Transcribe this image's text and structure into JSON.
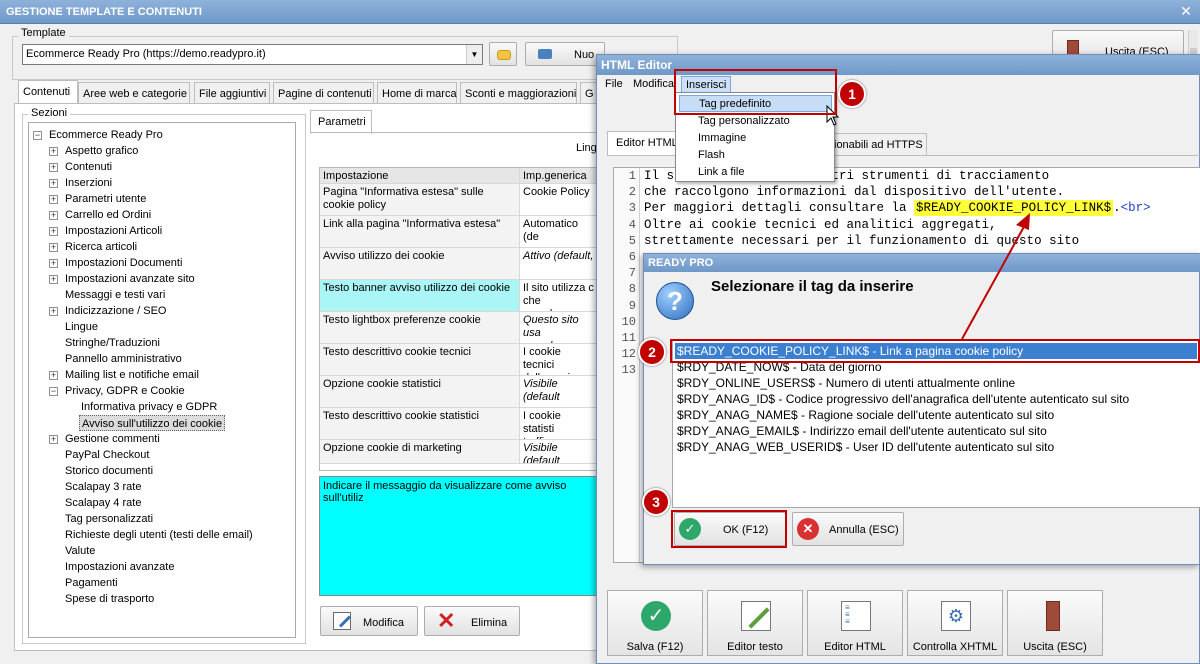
{
  "main": {
    "title": "GESTIONE TEMPLATE E CONTENUTI",
    "close": "✕",
    "template_label": "Template",
    "template_value": "Ecommerce Ready Pro (https://demo.readypro.it)",
    "new_button": "Nuo",
    "exit_button": "Uscita (ESC)",
    "tabs": [
      "Contenuti",
      "Aree web e categorie",
      "File aggiuntivi",
      "Pagine di contenuti",
      "Home di marca",
      "Sconti e maggiorazioni",
      "G"
    ],
    "sections_label": "Sezioni",
    "tree": [
      {
        "label": "Ecommerce Ready Pro",
        "level": 0,
        "toggle": "−"
      },
      {
        "label": "Aspetto grafico",
        "level": 1,
        "toggle": "+"
      },
      {
        "label": "Contenuti",
        "level": 1,
        "toggle": "+"
      },
      {
        "label": "Inserzioni",
        "level": 1,
        "toggle": "+"
      },
      {
        "label": "Parametri utente",
        "level": 1,
        "toggle": "+"
      },
      {
        "label": "Carrello ed Ordini",
        "level": 1,
        "toggle": "+"
      },
      {
        "label": "Impostazioni Articoli",
        "level": 1,
        "toggle": "+"
      },
      {
        "label": "Ricerca articoli",
        "level": 1,
        "toggle": "+"
      },
      {
        "label": "Impostazioni Documenti",
        "level": 1,
        "toggle": "+"
      },
      {
        "label": "Impostazioni avanzate sito",
        "level": 1,
        "toggle": "+"
      },
      {
        "label": "Messaggi e testi vari",
        "level": 1,
        "toggle": ""
      },
      {
        "label": "Indicizzazione / SEO",
        "level": 1,
        "toggle": "+"
      },
      {
        "label": "Lingue",
        "level": 1,
        "toggle": ""
      },
      {
        "label": "Stringhe/Traduzioni",
        "level": 1,
        "toggle": ""
      },
      {
        "label": "Pannello amministrativo",
        "level": 1,
        "toggle": ""
      },
      {
        "label": "Mailing list e notifiche email",
        "level": 1,
        "toggle": "+"
      },
      {
        "label": "Privacy, GDPR e Cookie",
        "level": 1,
        "toggle": "−"
      },
      {
        "label": "Informativa privacy e GDPR",
        "level": 2,
        "toggle": ""
      },
      {
        "label": "Avviso sull'utilizzo dei cookie",
        "level": 2,
        "toggle": "",
        "selected": true
      },
      {
        "label": "Gestione commenti",
        "level": 1,
        "toggle": "+"
      },
      {
        "label": "PayPal Checkout",
        "level": 1,
        "toggle": ""
      },
      {
        "label": "Storico documenti",
        "level": 1,
        "toggle": ""
      },
      {
        "label": "Scalapay 3 rate",
        "level": 1,
        "toggle": ""
      },
      {
        "label": "Scalapay 4 rate",
        "level": 1,
        "toggle": ""
      },
      {
        "label": "Tag personalizzati",
        "level": 1,
        "toggle": ""
      },
      {
        "label": "Richieste degli utenti (testi delle email)",
        "level": 1,
        "toggle": ""
      },
      {
        "label": "Valute",
        "level": 1,
        "toggle": ""
      },
      {
        "label": "Impostazioni avanzate",
        "level": 1,
        "toggle": ""
      },
      {
        "label": "Pagamenti",
        "level": 1,
        "toggle": ""
      },
      {
        "label": "Spese di trasporto",
        "level": 1,
        "toggle": ""
      }
    ],
    "params_tab": "Parametri",
    "lingua_label": "Ling",
    "grid_headers": [
      "Impostazione",
      "Imp.generica"
    ],
    "grid_rows": [
      {
        "name": "Pagina \"Informativa estesa\" sulle cookie policy",
        "value": "Cookie Policy",
        "italic": false
      },
      {
        "name": "Link alla pagina \"Informativa estesa\"",
        "value": "Automatico (de",
        "italic": false
      },
      {
        "name": "Avviso utilizzo dei cookie",
        "value": "Attivo (default,",
        "italic": true
      },
      {
        "name": "Testo banner avviso utilizzo dei cookie",
        "value": "Il sito utilizza c\nche raccolgono",
        "italic": false,
        "highlight": true
      },
      {
        "name": "Testo lightbox preferenze cookie",
        "value": "Questo sito usa\nraccolgono info",
        "italic": true
      },
      {
        "name": "Testo descrittivo cookie tecnici",
        "value": "I cookie tecnici\ndella pagina, l'i",
        "italic": false
      },
      {
        "name": "Opzione cookie statistici",
        "value": "Visibile (default",
        "italic": true
      },
      {
        "name": "Testo descrittivo cookie statistici",
        "value": "I cookie statisti\ntraffico per l'ela",
        "italic": false
      },
      {
        "name": "Opzione cookie di marketing",
        "value": "Visibile (default",
        "italic": true
      }
    ],
    "hint": "Indicare il messaggio da visualizzare come avviso sull'utiliz",
    "edit_button": "Modifica",
    "delete_button": "Elimina"
  },
  "editor": {
    "title": "HTML Editor",
    "menu": [
      "File",
      "Modifica",
      "Inserisci"
    ],
    "tabs": [
      "Editor HTML",
      "ionabili ad HTTPS"
    ],
    "dropdown": [
      "Tag predefinito",
      "Tag personalizzato",
      "Immagine",
      "Flash",
      "Link a file"
    ],
    "code_lines": [
      {
        "n": "1",
        "text": "Il s                ed altri strumenti di tracciamento"
      },
      {
        "n": "2",
        "text": "che raccolgono informazioni dal dispositivo dell'utente."
      },
      {
        "n": "3",
        "pre": "Per maggiori dettagli consultare la ",
        "tag": "$READY_COOKIE_POLICY_LINK$",
        "post": ".",
        "br": "<br>"
      },
      {
        "n": "4",
        "text": "Oltre ai cookie tecnici ed analitici aggregati,"
      },
      {
        "n": "5",
        "text": "strettamente necessari per il funzionamento di questo sito"
      },
      {
        "n": "6",
        "text": ""
      },
      {
        "n": "7",
        "text": ""
      },
      {
        "n": "8",
        "text": ""
      },
      {
        "n": "9",
        "text": ""
      },
      {
        "n": "10",
        "text": ""
      },
      {
        "n": "11",
        "text": ""
      },
      {
        "n": "12",
        "text": ""
      },
      {
        "n": "13",
        "text": ""
      }
    ],
    "bottom_buttons": [
      "Salva (F12)",
      "Editor testo",
      "Editor HTML",
      "Controlla XHTML",
      "Uscita (ESC)"
    ]
  },
  "dialog": {
    "title": "READY PRO",
    "heading": "Selezionare il tag da inserire",
    "tags": [
      "$READY_COOKIE_POLICY_LINK$ - Link a pagina cookie policy",
      "$RDY_DATE_NOW$ - Data del giorno",
      "$RDY_ONLINE_USERS$ - Numero di utenti attualmente online",
      "$RDY_ANAG_ID$ - Codice progressivo dell'anagrafica dell'utente autenticato sul sito",
      "$RDY_ANAG_NAME$ - Ragione sociale dell'utente autenticato sul sito",
      "$RDY_ANAG_EMAIL$ - Indirizzo email dell'utente autenticato sul sito",
      "$RDY_ANAG_WEB_USERID$ - User ID dell'utente autenticato sul sito"
    ],
    "ok_button": "OK (F12)",
    "cancel_button": "Annulla (ESC)"
  },
  "badges": [
    "1",
    "2",
    "3"
  ],
  "colors": {
    "accent_red": "#c00000",
    "selection_blue": "#3a7fd0",
    "highlight_cyan": "#aaf5f5",
    "tag_yellow": "#ffff3a"
  }
}
